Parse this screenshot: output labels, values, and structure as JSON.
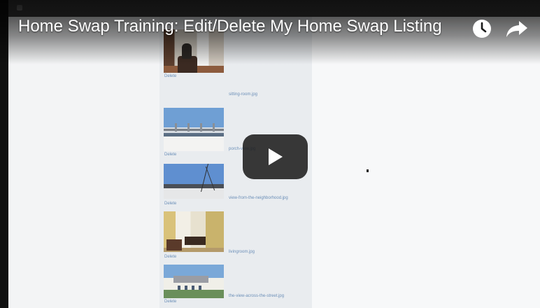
{
  "video": {
    "title": "Home Swap Training: Edit/Delete My Home Swap Listing"
  },
  "controls": {
    "watch_later_icon": "clock-icon",
    "share_icon": "share-arrow-icon",
    "play_icon": "play-icon"
  },
  "colors": {
    "play_button_bg": "#1e1e1e",
    "title_text": "#ffffff",
    "link_text": "#6c8fb8"
  },
  "photos": [
    {
      "filename": "sitting-room.jpg",
      "delete_label": "Delete"
    },
    {
      "filename": "porch-view.jpg",
      "delete_label": "Delete"
    },
    {
      "filename": "view-from-the-neighborhood.jpg",
      "delete_label": "Delete"
    },
    {
      "filename": "livingroom.jpg",
      "delete_label": "Delete"
    },
    {
      "filename": "the-view-across-the-street.jpg",
      "delete_label": "Delete"
    }
  ]
}
